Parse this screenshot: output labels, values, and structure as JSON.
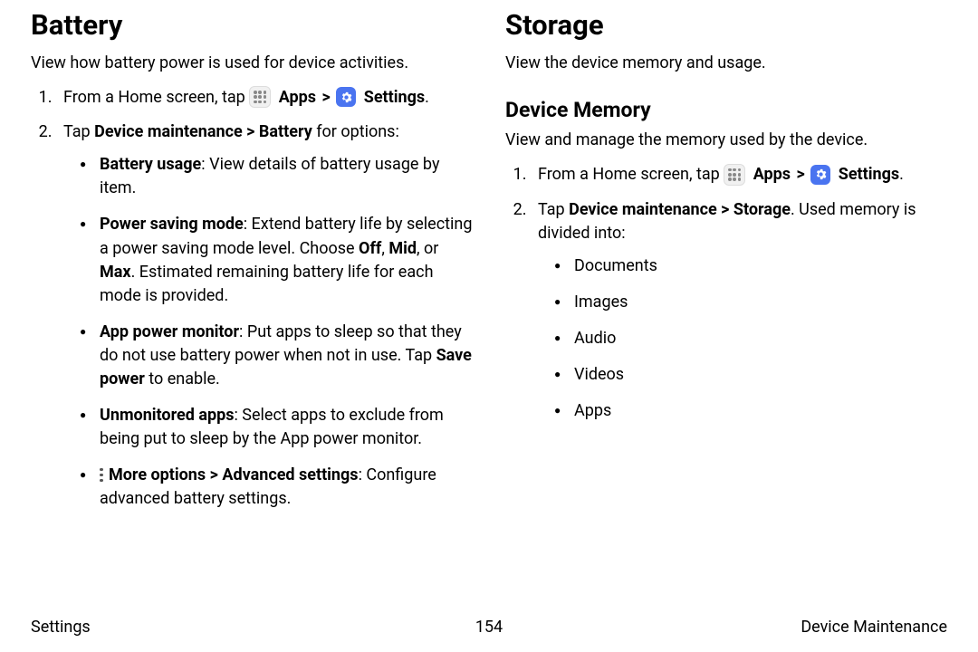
{
  "left": {
    "title": "Battery",
    "intro": "View how battery power is used for device activities.",
    "step1_prefix": "From a Home screen, tap ",
    "step1_apps": "Apps",
    "step1_settings": "Settings",
    "step2_prefix": "Tap ",
    "step2_bold": "Device maintenance > Battery",
    "step2_suffix": " for options:",
    "bullets": {
      "b1_bold": "Battery usage",
      "b1_rest": ": View details of battery usage by item.",
      "b2_bold": "Power saving mode",
      "b2_mid1": ": Extend battery life by selecting a power saving mode level. Choose ",
      "b2_off": "Off",
      "b2_c1": ", ",
      "b2_mid": "Mid",
      "b2_c2": ", or ",
      "b2_max": "Max",
      "b2_rest": ". Estimated remaining battery life for each mode is provided.",
      "b3_bold": "App power monitor",
      "b3_mid": ": Put apps to sleep so that they do not use battery power when not in use. Tap ",
      "b3_save": "Save power",
      "b3_end": " to enable.",
      "b4_bold": "Unmonitored apps",
      "b4_rest": ": Select apps to exclude from being put to sleep by the App power monitor.",
      "b5_bold": "More options > Advanced settings",
      "b5_rest": ": Configure advanced battery settings."
    }
  },
  "right": {
    "title": "Storage",
    "intro": "View the device memory and usage.",
    "subtitle": "Device Memory",
    "subintro": "View and manage the memory used by the device.",
    "step1_prefix": "From a Home screen, tap ",
    "step1_apps": "Apps",
    "step1_settings": "Settings",
    "step2_prefix": "Tap ",
    "step2_bold": "Device maintenance > Storage",
    "step2_suffix": ". Used memory is divided into:",
    "mem_items": {
      "i1": "Documents",
      "i2": "Images",
      "i3": "Audio",
      "i4": "Videos",
      "i5": "Apps"
    }
  },
  "footer": {
    "left": "Settings",
    "center": "154",
    "right": "Device Maintenance"
  },
  "chev": ">"
}
